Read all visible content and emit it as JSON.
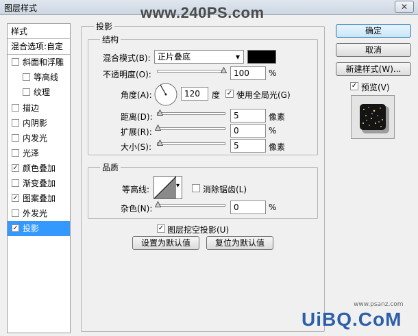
{
  "window": {
    "title": "图层样式",
    "close_label": "✕",
    "watermark": "www.240PS.com"
  },
  "left_panel": {
    "header": "样式",
    "blend_options": "混合选项:自定",
    "items": [
      {
        "label": "斜面和浮雕",
        "checked": false,
        "check": ""
      },
      {
        "label": "等高线",
        "checked": false,
        "check": ""
      },
      {
        "label": "纹理",
        "checked": false,
        "check": ""
      },
      {
        "label": "描边",
        "checked": false,
        "check": ""
      },
      {
        "label": "内阴影",
        "checked": false,
        "check": ""
      },
      {
        "label": "内发光",
        "checked": false,
        "check": ""
      },
      {
        "label": "光泽",
        "checked": false,
        "check": ""
      },
      {
        "label": "颜色叠加",
        "checked": true,
        "check": "✓"
      },
      {
        "label": "渐变叠加",
        "checked": false,
        "check": ""
      },
      {
        "label": "图案叠加",
        "checked": true,
        "check": "✓"
      },
      {
        "label": "外发光",
        "checked": false,
        "check": ""
      },
      {
        "label": "投影",
        "checked": true,
        "check": "✓",
        "selected": true
      }
    ]
  },
  "shadow": {
    "section_title": "投影",
    "structure": {
      "title": "结构",
      "blend_mode_label": "混合模式(B):",
      "blend_mode_value": "正片叠底",
      "color": "#000000",
      "opacity_label": "不透明度(O):",
      "opacity_value": "100",
      "opacity_unit": "%",
      "opacity_fraction": 1.0,
      "angle_label": "角度(A):",
      "angle_value": "120",
      "angle_unit": "度",
      "global_light_label": "使用全局光(G)",
      "global_light_checked": "✓",
      "distance_label": "距离(D):",
      "distance_value": "5",
      "distance_unit": "像素",
      "spread_label": "扩展(R):",
      "spread_value": "0",
      "spread_unit": "%",
      "size_label": "大小(S):",
      "size_value": "5",
      "size_unit": "像素"
    },
    "quality": {
      "title": "品质",
      "contour_label": "等高线:",
      "antialias_label": "消除锯齿(L)",
      "antialias_checked": "",
      "noise_label": "杂色(N):",
      "noise_value": "0",
      "noise_unit": "%"
    },
    "knockout_label": "图层挖空投影(U)",
    "knockout_checked": "✓",
    "make_default": "设置为默认值",
    "reset_default": "复位为默认值"
  },
  "buttons": {
    "ok": "确定",
    "cancel": "取消",
    "new_style": "新建样式(W)...",
    "preview_label": "预览(V)",
    "preview_checked": "✓"
  },
  "footer": {
    "brand": "UiBQ.CoM",
    "site": "www.psanz.com"
  }
}
